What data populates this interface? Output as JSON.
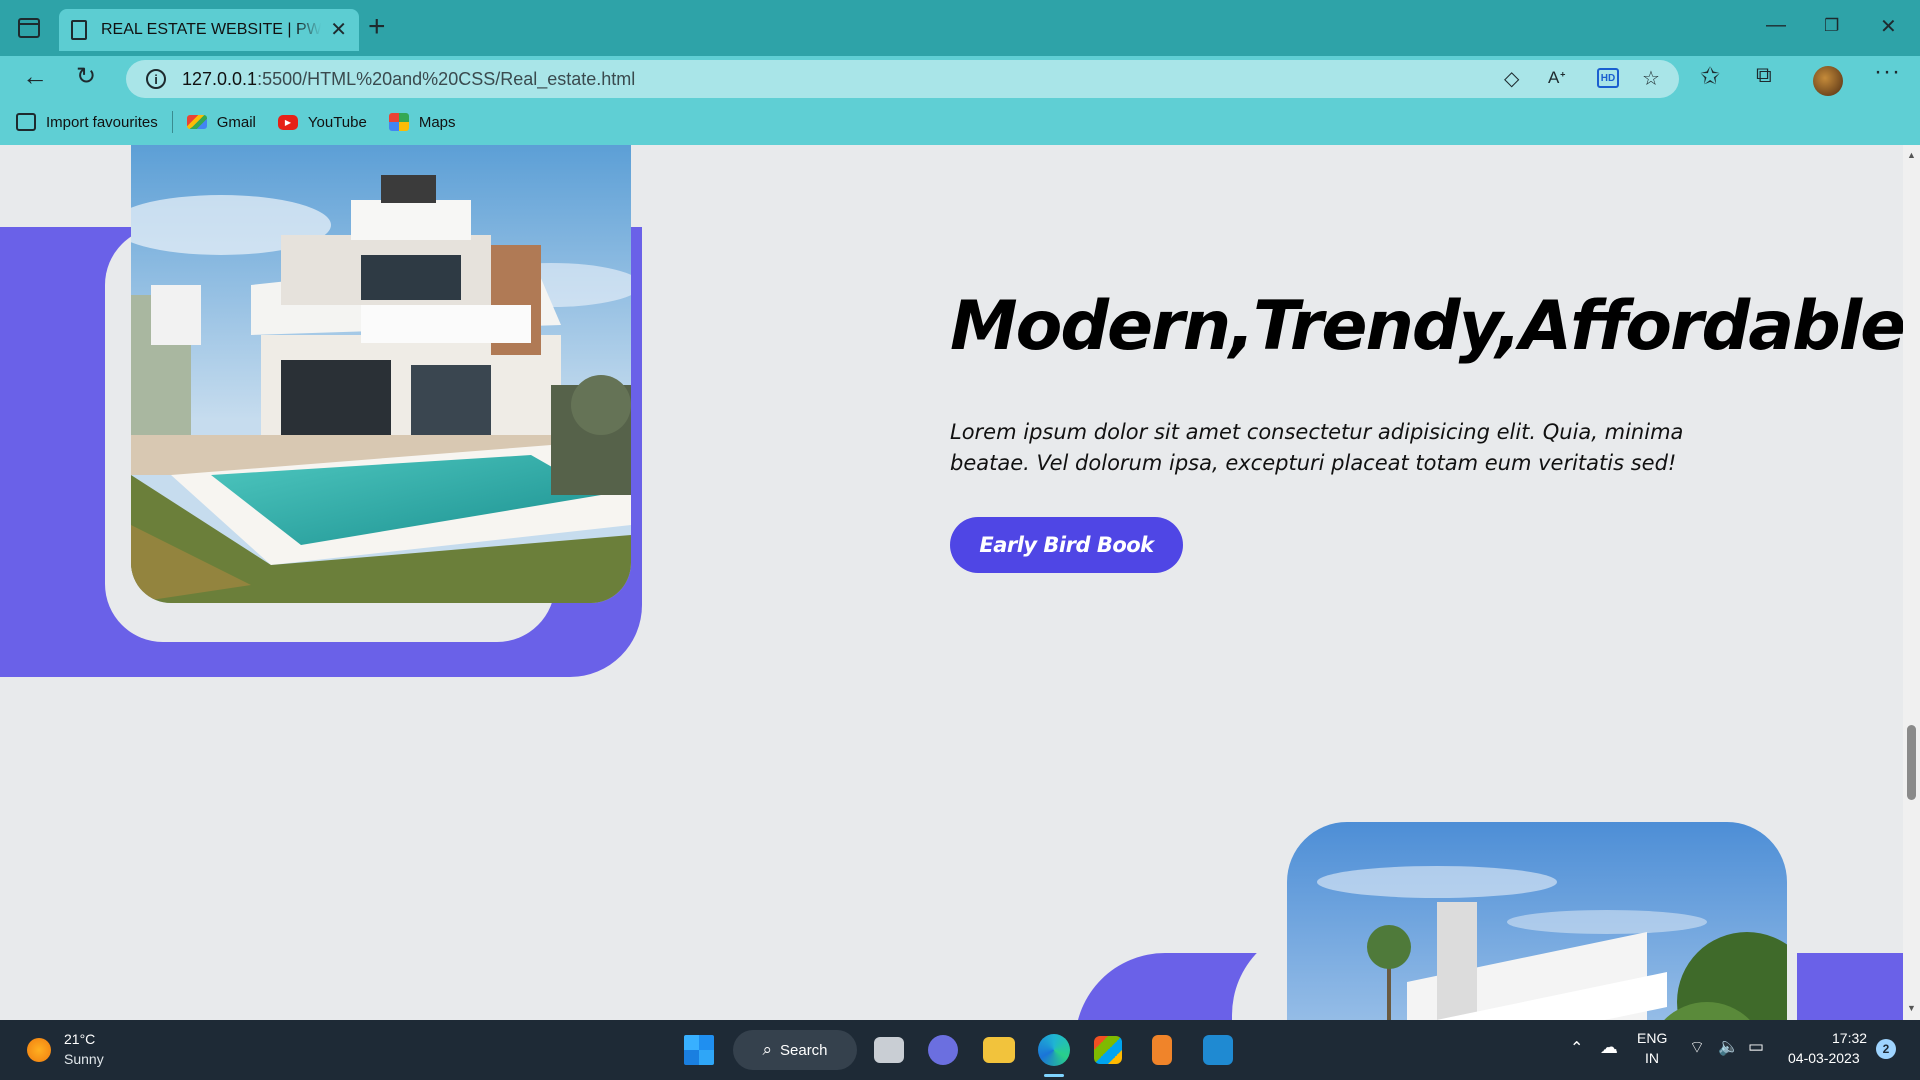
{
  "browser": {
    "tab_title": "REAL ESTATE WEBSITE | PW Assi",
    "url_host": "127.0.0.1",
    "url_path": ":5500/HTML%20and%20CSS/Real_estate.html",
    "bookmarks": [
      {
        "label": "Import favourites",
        "icon": "import-icon"
      },
      {
        "label": "Gmail",
        "icon": "gmail-icon"
      },
      {
        "label": "YouTube",
        "icon": "youtube-icon"
      },
      {
        "label": "Maps",
        "icon": "maps-icon"
      }
    ]
  },
  "page": {
    "hero_title": "Modern,Trendy,Affordable",
    "hero_text": "Lorem ipsum dolor sit amet consectetur adipisicing elit. Quia, minima beatae. Vel dolorum ipsa, excepturi placeat totam eum veritatis sed!",
    "hero_button": "Early Bird Book",
    "accent_color": "#4f46e5",
    "block_color": "#6a61e8"
  },
  "taskbar": {
    "weather_temp": "21°C",
    "weather_desc": "Sunny",
    "search_label": "Search",
    "lang_top": "ENG",
    "lang_bottom": "IN",
    "time": "17:32",
    "date": "04-03-2023",
    "notification_count": "2"
  }
}
